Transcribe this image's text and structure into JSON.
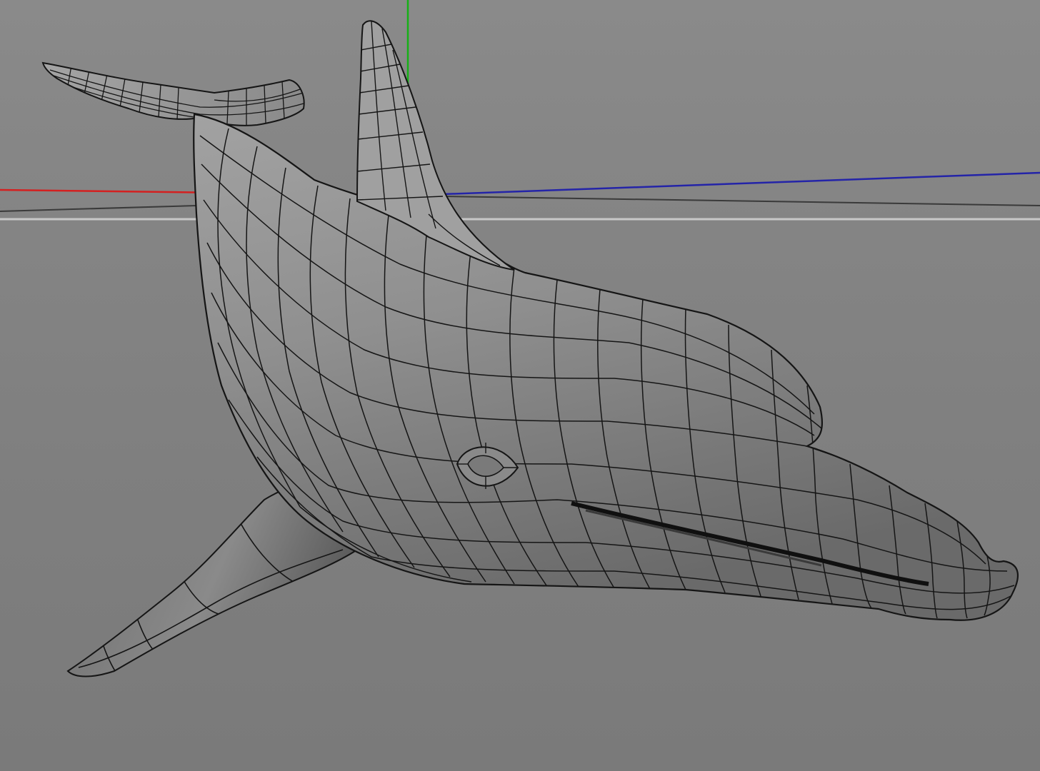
{
  "viewport": {
    "view": "perspective",
    "object": "dolphin",
    "display_mode": "gouraud-shading-with-wireframe-lines",
    "axis_colors": {
      "x": "#d42020",
      "y": "#16b016",
      "z": "#2424a8",
      "horizon": "#c8c8c8",
      "ground_line": "#3a3a3a"
    },
    "background_color": "#828282",
    "mesh_fill": "#8e8e8e",
    "wire_color": "#151515"
  }
}
